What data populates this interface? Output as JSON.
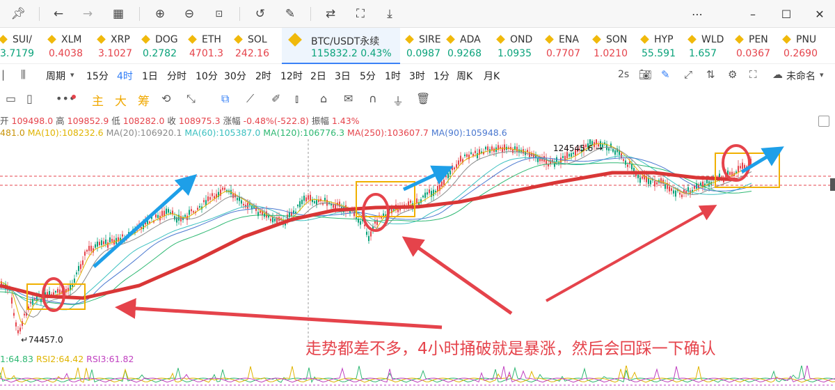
{
  "toolbar": {
    "icons": [
      "pin-icon",
      "back-icon",
      "forward-icon",
      "apps-icon",
      "zoom-in-icon",
      "zoom-out-icon",
      "fit-icon",
      "rotate-icon",
      "edit-icon",
      "translate-icon",
      "screenshot-icon",
      "save-icon",
      "more-icon",
      "minimize-icon",
      "maximize-icon",
      "close-icon"
    ]
  },
  "tickers": [
    {
      "symbol": "SUI/",
      "price": "3.7179",
      "dir": "up"
    },
    {
      "symbol": "XLM",
      "price": "0.4038",
      "dir": "down"
    },
    {
      "symbol": "XRP",
      "price": "3.1027",
      "dir": "down"
    },
    {
      "symbol": "DOG",
      "price": "0.2782",
      "dir": "up"
    },
    {
      "symbol": "ETH",
      "price": "4701.3",
      "dir": "down"
    },
    {
      "symbol": "SOL",
      "price": "242.16",
      "dir": "down"
    },
    {
      "symbol": "BTC/USDT永续",
      "price": "115832.2",
      "change": "0.43%",
      "dir": "up",
      "active": true
    },
    {
      "symbol": "SIRE",
      "price": "0.0987",
      "dir": "up"
    },
    {
      "symbol": "ADA",
      "price": "0.9268",
      "dir": "up"
    },
    {
      "symbol": "OND",
      "price": "1.0935",
      "dir": "up"
    },
    {
      "symbol": "ENA",
      "price": "0.7707",
      "dir": "down"
    },
    {
      "symbol": "SON",
      "price": "1.0210",
      "dir": "down"
    },
    {
      "symbol": "HYP",
      "price": "55.591",
      "dir": "up"
    },
    {
      "symbol": "WLD",
      "price": "1.657",
      "dir": "up"
    },
    {
      "symbol": "PEN",
      "price": "0.0367",
      "dir": "down"
    },
    {
      "symbol": "PNU",
      "price": "0.2690",
      "dir": "down"
    }
  ],
  "intervals": {
    "period_label": "周期",
    "items": [
      "15分",
      "4时",
      "1日",
      "分时",
      "10分",
      "30分",
      "2时",
      "12时",
      "2日",
      "3日",
      "5分",
      "1时",
      "3时",
      "1分",
      "周K",
      "月K"
    ],
    "selected": "4时",
    "refresh": "2s",
    "layout_name": "未命名"
  },
  "tools": {
    "labels": [
      "主",
      "大",
      "筹"
    ]
  },
  "ohlc": {
    "open_label": "开",
    "open": "109498.0",
    "high_label": "高",
    "high": "109852.9",
    "low_label": "低",
    "low": "108282.0",
    "close_label": "收",
    "close": "108975.3",
    "change_label": "涨幅",
    "change": "-0.48%(-522.8)",
    "amp_label": "振幅",
    "amp": "1.43%"
  },
  "ma": [
    {
      "label": "481.0",
      "color": "#c8940a"
    },
    {
      "label": "MA(10):108232.6",
      "color": "#e0b400"
    },
    {
      "label": "MA(20):106920.1",
      "color": "#8a8a8a"
    },
    {
      "label": "MA(60):105387.0",
      "color": "#3cc0c0"
    },
    {
      "label": "MA(120):106776.3",
      "color": "#2eb872"
    },
    {
      "label": "MA(250):103607.7",
      "color": "#e5434b"
    },
    {
      "label": "MA(90):105948.6",
      "color": "#4a78d0"
    }
  ],
  "chart": {
    "high_marker": "124545.6",
    "low_marker": "74457.0"
  },
  "rsi": [
    {
      "label": "1:64.83",
      "color": "#2eb872"
    },
    {
      "label": "RSI2:64.42",
      "color": "#e0b400"
    },
    {
      "label": "RSI3:61.82",
      "color": "#c040c0"
    }
  ],
  "annotation": "走势都差不多，4小时捅破就是暴涨，然后会回踩一下确认"
}
